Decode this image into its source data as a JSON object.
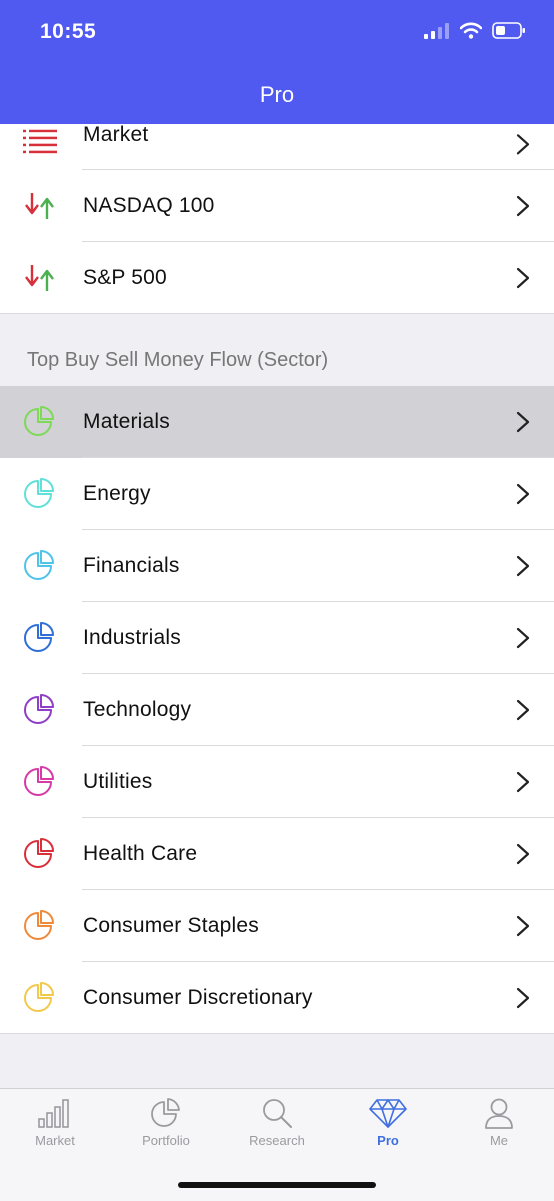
{
  "status": {
    "time": "10:55"
  },
  "nav": {
    "title": "Pro"
  },
  "top_items": [
    {
      "label": "Market",
      "icon": "list-icon"
    },
    {
      "label": "NASDAQ 100",
      "icon": "up-down-arrows-icon"
    },
    {
      "label": "S&P 500",
      "icon": "up-down-arrows-icon"
    }
  ],
  "section": {
    "title": "Top Buy Sell Money Flow (Sector)"
  },
  "sectors": [
    {
      "label": "Materials",
      "color": "#7ed957",
      "selected": true
    },
    {
      "label": "Energy",
      "color": "#5fe0d8"
    },
    {
      "label": "Financials",
      "color": "#4fc3e8"
    },
    {
      "label": "Industrials",
      "color": "#2f6fd8"
    },
    {
      "label": "Technology",
      "color": "#8e3fc7"
    },
    {
      "label": "Utilities",
      "color": "#d63aa5"
    },
    {
      "label": "Health Care",
      "color": "#d8303a"
    },
    {
      "label": "Consumer Staples",
      "color": "#ef8a3b"
    },
    {
      "label": "Consumer Discretionary",
      "color": "#f2c94c"
    }
  ],
  "tabs": [
    {
      "label": "Market",
      "icon": "bar-chart-icon"
    },
    {
      "label": "Portfolio",
      "icon": "pie-chart-icon"
    },
    {
      "label": "Research",
      "icon": "search-icon"
    },
    {
      "label": "Pro",
      "icon": "diamond-icon",
      "active": true
    },
    {
      "label": "Me",
      "icon": "person-icon"
    }
  ],
  "colors": {
    "accent": "#5059f0",
    "tab_active": "#3f6fe0"
  }
}
